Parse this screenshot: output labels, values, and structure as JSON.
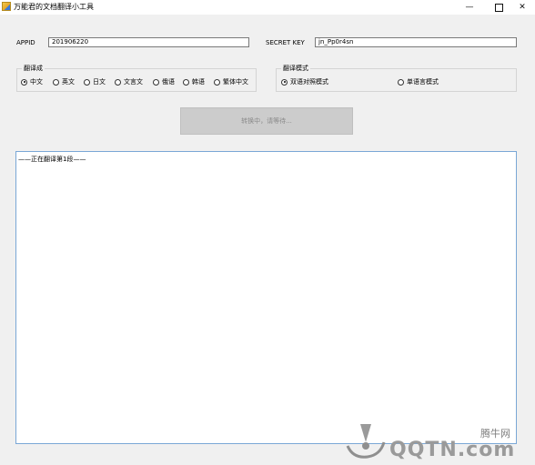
{
  "window": {
    "title": "万能君的文档翻译小工具",
    "min_glyph": "—",
    "close_glyph": "✕"
  },
  "credentials": {
    "appid_label": "APPID",
    "appid_value": "201906220",
    "secret_label": "SECRET KEY",
    "secret_value": "jn_Pp0r4sn"
  },
  "translate_to": {
    "legend": "翻译成",
    "options": [
      {
        "label": "中文",
        "selected": true
      },
      {
        "label": "英文",
        "selected": false
      },
      {
        "label": "日文",
        "selected": false
      },
      {
        "label": "文言文",
        "selected": false
      },
      {
        "label": "俄语",
        "selected": false
      },
      {
        "label": "韩语",
        "selected": false
      },
      {
        "label": "繁体中文",
        "selected": false
      }
    ]
  },
  "mode": {
    "legend": "翻译模式",
    "options": [
      {
        "label": "双语对照模式",
        "selected": true
      },
      {
        "label": "单语言模式",
        "selected": false
      }
    ]
  },
  "action": {
    "button_label": "转换中，请等待..."
  },
  "output": {
    "text": "——正在翻译第1段——"
  },
  "watermark": {
    "site": "腾牛网",
    "logo": "QQTN.com"
  },
  "colors": {
    "background": "#f0f0f0",
    "accent_border": "#7aa7d6",
    "disabled_button": "#cccccc"
  }
}
